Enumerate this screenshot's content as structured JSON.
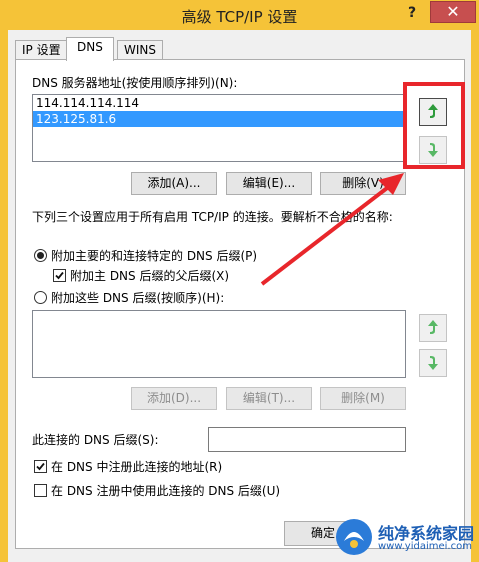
{
  "window": {
    "title": "高级 TCP/IP 设置",
    "help_label": "?",
    "close_label": "✕"
  },
  "tabs": [
    {
      "label": "IP 设置",
      "active": false
    },
    {
      "label": "DNS",
      "active": true
    },
    {
      "label": "WINS",
      "active": false
    }
  ],
  "dns_servers": {
    "label": "DNS 服务器地址(按使用顺序排列)(N):",
    "items": [
      {
        "text": "114.114.114.114",
        "selected": false
      },
      {
        "text": "123.125.81.6",
        "selected": true
      }
    ],
    "buttons": {
      "add": "添加(A)...",
      "edit": "编辑(E)...",
      "remove": "删除(V)"
    }
  },
  "info_text": "下列三个设置应用于所有启用 TCP/IP 的连接。要解析不合格的名称:",
  "options": {
    "primary_suffix": {
      "label": "附加主要的和连接特定的 DNS 后缀(P)",
      "checked": true
    },
    "parent_suffix": {
      "label": "附加主 DNS 后缀的父后缀(X)",
      "checked": true
    },
    "these_suffixes": {
      "label": "附加这些 DNS 后缀(按顺序)(H):",
      "checked": false
    }
  },
  "suffix_list": {
    "items": [],
    "buttons": {
      "add": "添加(D)...",
      "edit": "编辑(T)...",
      "remove": "删除(M)"
    }
  },
  "connection_suffix": {
    "label": "此连接的 DNS 后缀(S):",
    "value": ""
  },
  "register": {
    "register_address": {
      "label": "在 DNS 中注册此连接的地址(R)",
      "checked": true
    },
    "use_suffix": {
      "label": "在 DNS 注册中使用此连接的 DNS 后缀(U)",
      "checked": false
    }
  },
  "footer": {
    "ok_label": "确定"
  },
  "annotation": {
    "color": "#e8262b"
  },
  "watermark": {
    "title": "纯净系统家园",
    "url": "www.yidaimei.com"
  },
  "colors": {
    "titlebar": "#f5c338",
    "close": "#c74f4f",
    "selection": "#3399ff",
    "arrow_green": "#2e9b3b"
  }
}
